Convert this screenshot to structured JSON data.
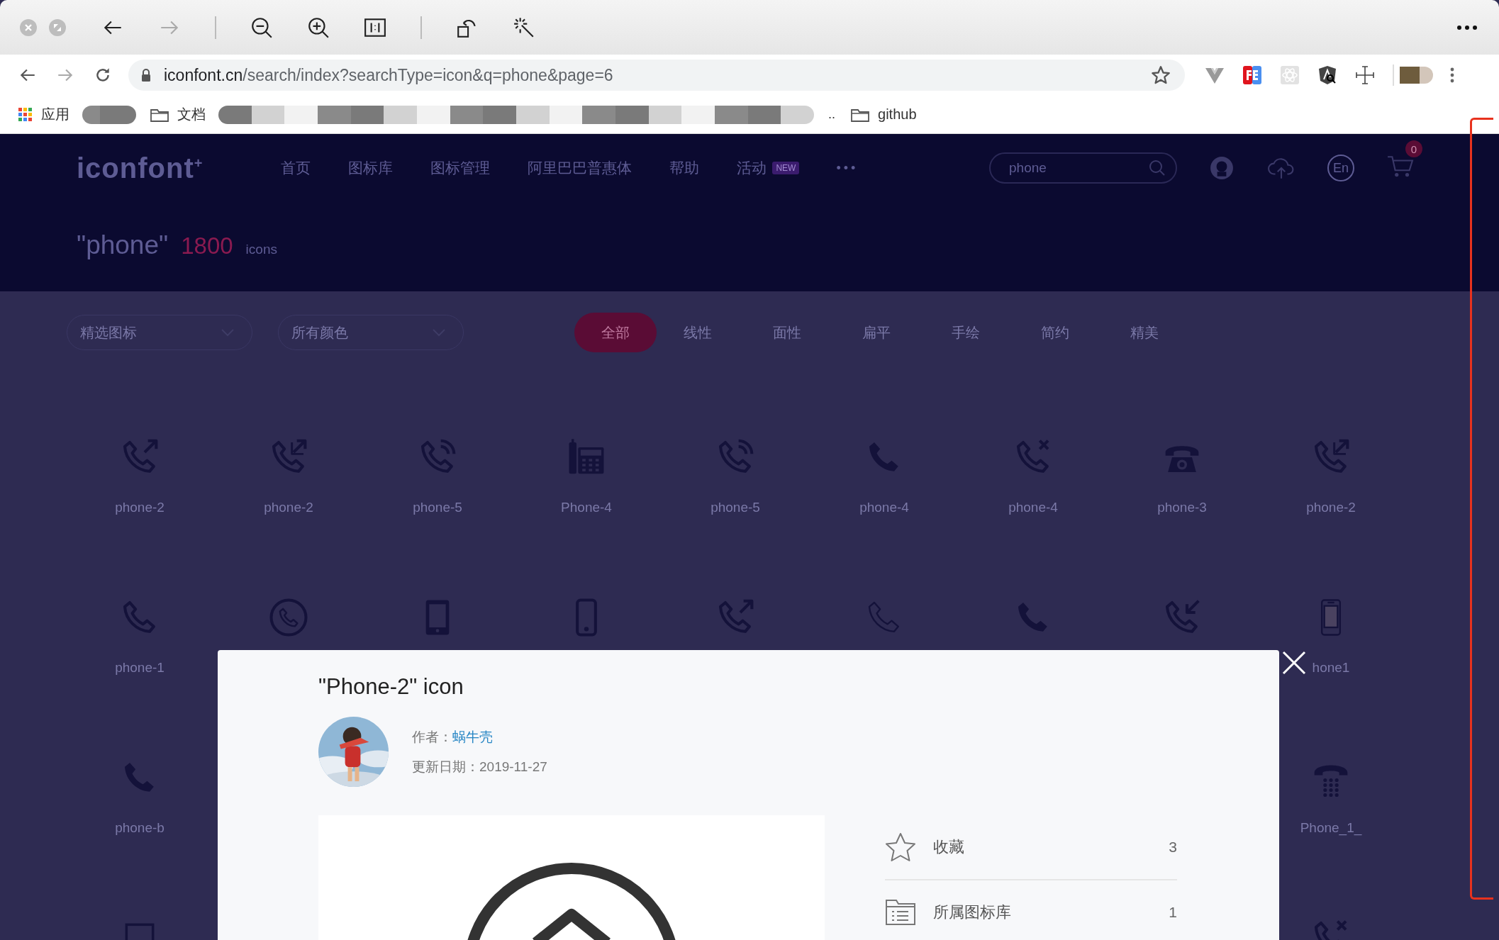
{
  "browser": {
    "url_host": "iconfont.cn",
    "url_path": "/search/index?searchType=icon&q=phone&page=6"
  },
  "bookmarks": [
    {
      "kind": "apps",
      "label": "应用"
    },
    {
      "kind": "blur-short"
    },
    {
      "kind": "folder",
      "label": "文档"
    },
    {
      "kind": "blur-long"
    },
    {
      "kind": "text",
      "label": ".."
    },
    {
      "kind": "folder",
      "label": "github"
    }
  ],
  "site": {
    "logo": "iconfont",
    "logo_mark": "+",
    "nav": [
      {
        "label": "首页"
      },
      {
        "label": "图标库"
      },
      {
        "label": "图标管理"
      },
      {
        "label": "阿里巴巴普惠体"
      },
      {
        "label": "帮助"
      },
      {
        "label": "活动",
        "badge": "NEW"
      }
    ],
    "more": "•••",
    "search": {
      "value": "phone"
    },
    "language": "En",
    "cart_badge": "0"
  },
  "results": {
    "query": "\"phone\"",
    "count": "1800",
    "unit": "icons"
  },
  "filters": {
    "dropdowns": [
      "精选图标",
      "所有颜色"
    ],
    "styles": [
      {
        "label": "全部",
        "selected": true
      },
      {
        "label": "线性",
        "selected": false
      },
      {
        "label": "面性",
        "selected": false
      },
      {
        "label": "扁平",
        "selected": false
      },
      {
        "label": "手绘",
        "selected": false
      },
      {
        "label": "简约",
        "selected": false
      },
      {
        "label": "精美",
        "selected": false
      }
    ]
  },
  "grid": [
    {
      "items": [
        {
          "kind": "outgoing",
          "label": "phone-2"
        },
        {
          "kind": "outgoing-box",
          "label": "phone-2"
        },
        {
          "kind": "ringing",
          "label": "phone-5"
        },
        {
          "kind": "desk-phone",
          "label": "Phone-4"
        },
        {
          "kind": "ringing",
          "label": "phone-5"
        },
        {
          "kind": "outgoing-solid",
          "label": "phone-4"
        },
        {
          "kind": "missed",
          "label": "phone-4"
        },
        {
          "kind": "rotary",
          "label": "phone-3"
        },
        {
          "kind": "outgoing-box",
          "label": "phone-2"
        }
      ]
    },
    {
      "items": [
        {
          "kind": "handset",
          "label": "phone-1"
        },
        {
          "kind": "handset-circle"
        },
        {
          "kind": "tablet"
        },
        {
          "kind": "mobile"
        },
        {
          "kind": "outgoing"
        },
        {
          "kind": "handset-thin"
        },
        {
          "kind": "handset-solid"
        },
        {
          "kind": "incoming"
        },
        {
          "kind": "mobile-screen",
          "label": "hone1"
        }
      ]
    },
    {
      "items": [
        {
          "kind": "handset-solid",
          "label": "phone-b"
        },
        {
          "kind": "keypad-phone",
          "label": "Phone_1_"
        }
      ]
    },
    {
      "items": [
        {
          "kind": "square"
        },
        {
          "kind": "missed"
        }
      ]
    }
  ],
  "modal": {
    "title": "\"Phone-2\" icon",
    "author_label": "作者：",
    "author": "蜗牛壳",
    "updated": "更新日期：2019-11-27",
    "stats": [
      {
        "kind": "favorites",
        "label": "收藏",
        "count": "3"
      },
      {
        "kind": "libraries",
        "label": "所属图标库",
        "count": "1"
      }
    ]
  }
}
